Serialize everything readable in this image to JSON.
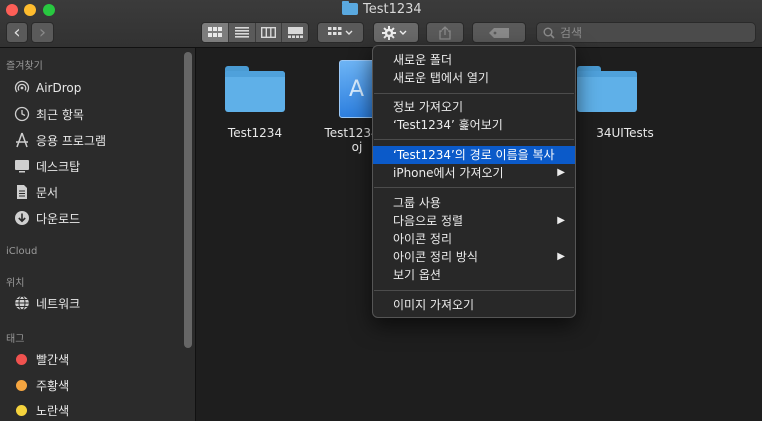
{
  "window": {
    "title": "Test1234"
  },
  "toolbar": {
    "back_glyph": "‹",
    "forward_glyph": "›",
    "search_placeholder": "검색",
    "icons": [
      "chevron-left-icon",
      "chevron-right-icon",
      "icon-view-icon",
      "list-view-icon",
      "column-view-icon",
      "gallery-view-icon",
      "group-icon",
      "gear-icon",
      "share-icon",
      "tag-icon",
      "search-icon"
    ]
  },
  "sidebar": {
    "favorites_title": "즐겨찾기",
    "favorites": [
      {
        "label": "AirDrop",
        "icon": "airdrop-icon"
      },
      {
        "label": "최근 항목",
        "icon": "clock-icon"
      },
      {
        "label": "응용 프로그램",
        "icon": "applications-icon"
      },
      {
        "label": "데스크탑",
        "icon": "desktop-icon"
      },
      {
        "label": "문서",
        "icon": "document-icon"
      },
      {
        "label": "다운로드",
        "icon": "download-icon"
      }
    ],
    "icloud_title": "iCloud",
    "locations_title": "위치",
    "locations": [
      {
        "label": "네트워크",
        "icon": "network-icon"
      }
    ],
    "tags_title": "태그",
    "tags": [
      {
        "label": "빨간색",
        "color": "#f0524f"
      },
      {
        "label": "주황색",
        "color": "#f5a540"
      },
      {
        "label": "노란색",
        "color": "#f5d33d"
      }
    ]
  },
  "files": [
    {
      "name": "Test1234",
      "type": "folder"
    },
    {
      "name": "Test1234.x",
      "name_line2": "oj",
      "type": "xcodeproj"
    },
    {
      "name": "34UITests",
      "type": "folder"
    }
  ],
  "context_menu": {
    "items": [
      {
        "label": "새로운 폴더"
      },
      {
        "label": "새로운 탭에서 열기"
      },
      {
        "label": "정보 가져오기"
      },
      {
        "label": "‘Test1234’ 훑어보기"
      },
      {
        "label": "‘Test1234’의 경로 이름을 복사",
        "selected": true
      },
      {
        "label": "iPhone에서 가져오기",
        "submenu": true
      },
      {
        "label": "그룹 사용"
      },
      {
        "label": "다음으로 정렬",
        "submenu": true
      },
      {
        "label": "아이콘 정리"
      },
      {
        "label": "아이콘 정리 방식",
        "submenu": true
      },
      {
        "label": "보기 옵션"
      },
      {
        "label": "이미지 가져오기"
      }
    ],
    "submenu_arrow": "▶"
  },
  "colors": {
    "selection": "#0b5ac9",
    "folder": "#5fb0e8"
  }
}
